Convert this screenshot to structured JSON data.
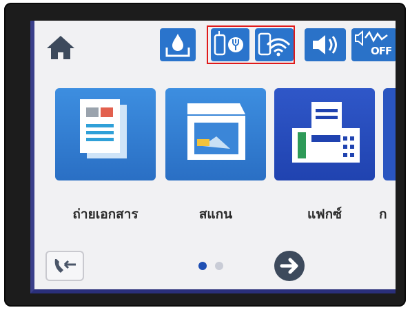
{
  "status_bar": {
    "home": {
      "icon": "home-icon"
    },
    "ink": {
      "icon": "ink-drop-icon"
    },
    "network": {
      "icons": [
        "wifi-direct-icon",
        "wifi-icon"
      ],
      "highlighted": true,
      "highlight_color": "#e01a1a"
    },
    "sound": {
      "icon": "speaker-icon"
    },
    "quiet_mode": {
      "icon": "quiet-mode-icon",
      "label": "OFF"
    }
  },
  "apps": [
    {
      "id": "copy",
      "label": "ถ่ายเอกสาร",
      "icon": "copy-icon"
    },
    {
      "id": "scan",
      "label": "สแกน",
      "icon": "scan-icon"
    },
    {
      "id": "fax",
      "label": "แฟกซ์",
      "icon": "fax-icon"
    },
    {
      "id": "more",
      "label": "ก",
      "icon": "more-icon"
    }
  ],
  "bottom_bar": {
    "contacts": {
      "icon": "fax-contacts-icon"
    },
    "page": {
      "current": 1,
      "total": 2
    },
    "next": {
      "icon": "arrow-right-icon"
    }
  },
  "colors": {
    "tile_blue": "#2a74cc",
    "fax_blue": "#2043b0",
    "screen_bg": "#f1f1f3",
    "page_dot_active": "#1f4fb3",
    "page_dot_inactive": "#c9ccd6"
  }
}
